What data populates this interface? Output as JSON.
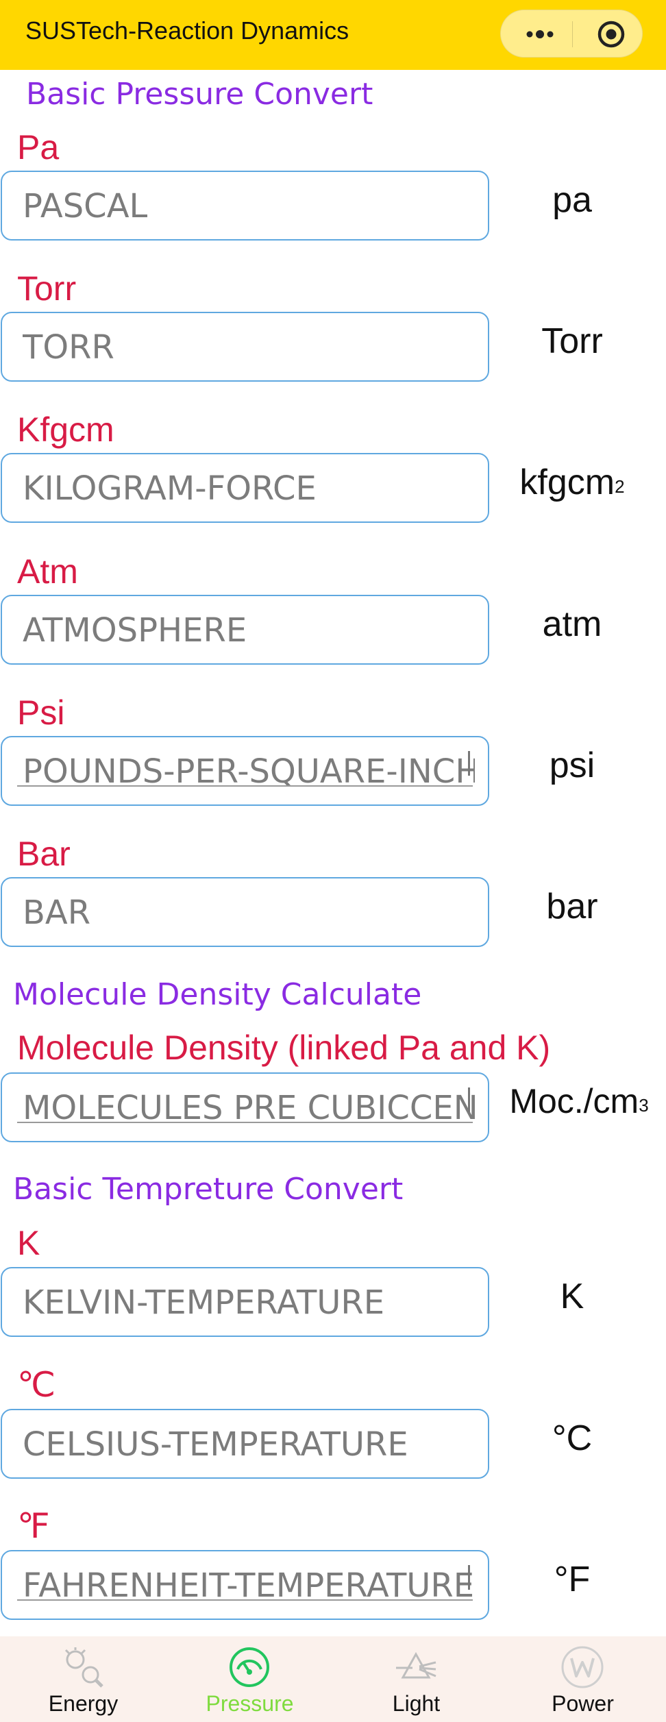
{
  "navbar": {
    "title": "SUSTech-Reaction Dynamics",
    "more_icon": "more-dots-icon",
    "close_icon": "record-circle-icon",
    "bg_color": "#FFD700"
  },
  "sections": {
    "pressure_title": "Basic Pressure Convert",
    "density_title": "Molecule Density Calculate",
    "temperature_title": "Basic Tempreture Convert"
  },
  "fields": {
    "pa": {
      "label": "Pa",
      "placeholder": "PASCAL",
      "unit": "pa"
    },
    "torr": {
      "label": "Torr",
      "placeholder": "TORR",
      "unit": "Torr"
    },
    "kfgcm": {
      "label": "Kfgcm",
      "placeholder": "KILOGRAM-FORCE",
      "unit": "kfgcm",
      "unit_sup": "2"
    },
    "atm": {
      "label": "Atm",
      "placeholder": "ATMOSPHERE",
      "unit": "atm"
    },
    "psi": {
      "label": "Psi",
      "placeholder": "POUNDS-PER-SQUARE-INCH",
      "unit": "psi"
    },
    "bar": {
      "label": "Bar",
      "placeholder": "BAR",
      "unit": "bar"
    },
    "density": {
      "label": "Molecule Density (linked Pa and K)",
      "placeholder": "MOLECULES PRE CUBICCENTIMETER",
      "unit": "Moc./cm",
      "unit_sup": "3"
    },
    "kelvin": {
      "label": "K",
      "placeholder": "KELVIN-TEMPERATURE",
      "unit": "K"
    },
    "celsius": {
      "label": "℃",
      "placeholder": "CELSIUS-TEMPERATURE",
      "unit": "°C"
    },
    "fahrenheit": {
      "label": "℉",
      "placeholder": "FAHRENHEIT-TEMPERATURE",
      "unit": "°F"
    }
  },
  "colors": {
    "section_title": "#8A2BE2",
    "field_label": "#D81B45",
    "field_border": "#5FA8E0",
    "tab_active": "#7FDB3F",
    "tabbar_bg": "#FBF1EC"
  },
  "tabbar": {
    "items": [
      {
        "label": "Energy",
        "icon": "energy-magnifier-icon",
        "active": false
      },
      {
        "label": "Pressure",
        "icon": "pressure-gauge-icon",
        "active": true
      },
      {
        "label": "Light",
        "icon": "prism-light-icon",
        "active": false
      },
      {
        "label": "Power",
        "icon": "power-w-icon",
        "active": false
      }
    ]
  }
}
